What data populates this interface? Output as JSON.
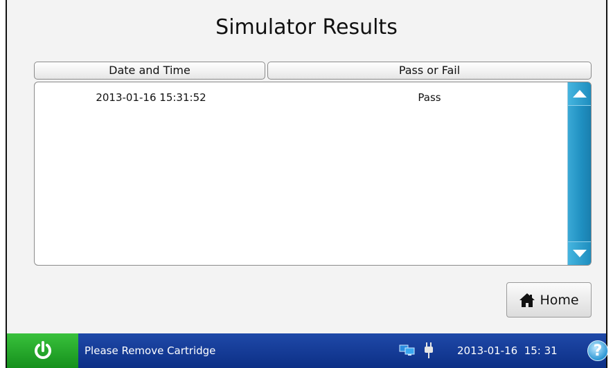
{
  "page": {
    "title": "Simulator Results"
  },
  "table": {
    "columns": [
      "Date and Time",
      "Pass or Fail"
    ],
    "rows": [
      {
        "date_time": "2013-01-16 15:31:52",
        "result": "Pass"
      }
    ]
  },
  "actions": {
    "home_label": "Home"
  },
  "statusbar": {
    "message": "Please Remove Cartridge",
    "clock": "2013-01-16  15: 31",
    "help_label": "?"
  },
  "colors": {
    "statusbar_blue": "#0c2f86",
    "power_green": "#15901c",
    "scrollbar_blue": "#1f8fc0"
  },
  "icons": {
    "power": "power-icon",
    "home": "home-icon",
    "network": "network-icon",
    "plug": "plug-icon",
    "help": "help-icon",
    "scroll_up": "arrow-up-icon",
    "scroll_down": "arrow-down-icon"
  }
}
